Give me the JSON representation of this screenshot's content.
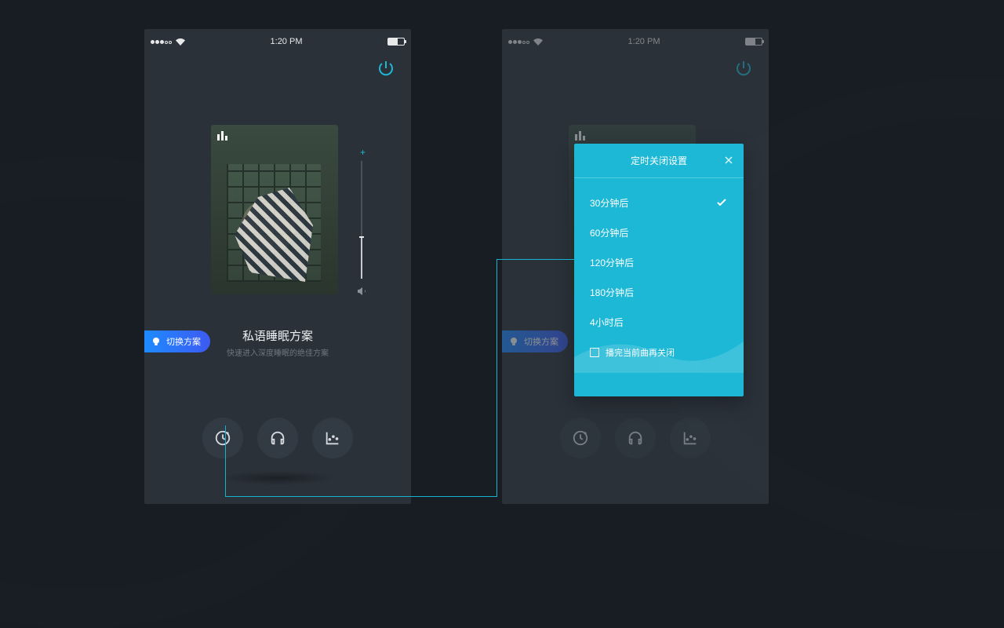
{
  "status": {
    "time": "1:20 PM"
  },
  "switch_label": "切换方案",
  "track": {
    "title": "私语睡眠方案",
    "subtitle": "快速进入深度睡眠的绝佳方案"
  },
  "modal": {
    "title": "定时关闭设置",
    "options": [
      "30分钟后",
      "60分钟后",
      "120分钟后",
      "180分钟后",
      "4小时后"
    ],
    "selected_index": 0,
    "footer_label": "播完当前曲再关闭"
  },
  "icons": {
    "timer": "timer-icon",
    "headphones": "headphones-icon",
    "chart": "chart-icon"
  }
}
